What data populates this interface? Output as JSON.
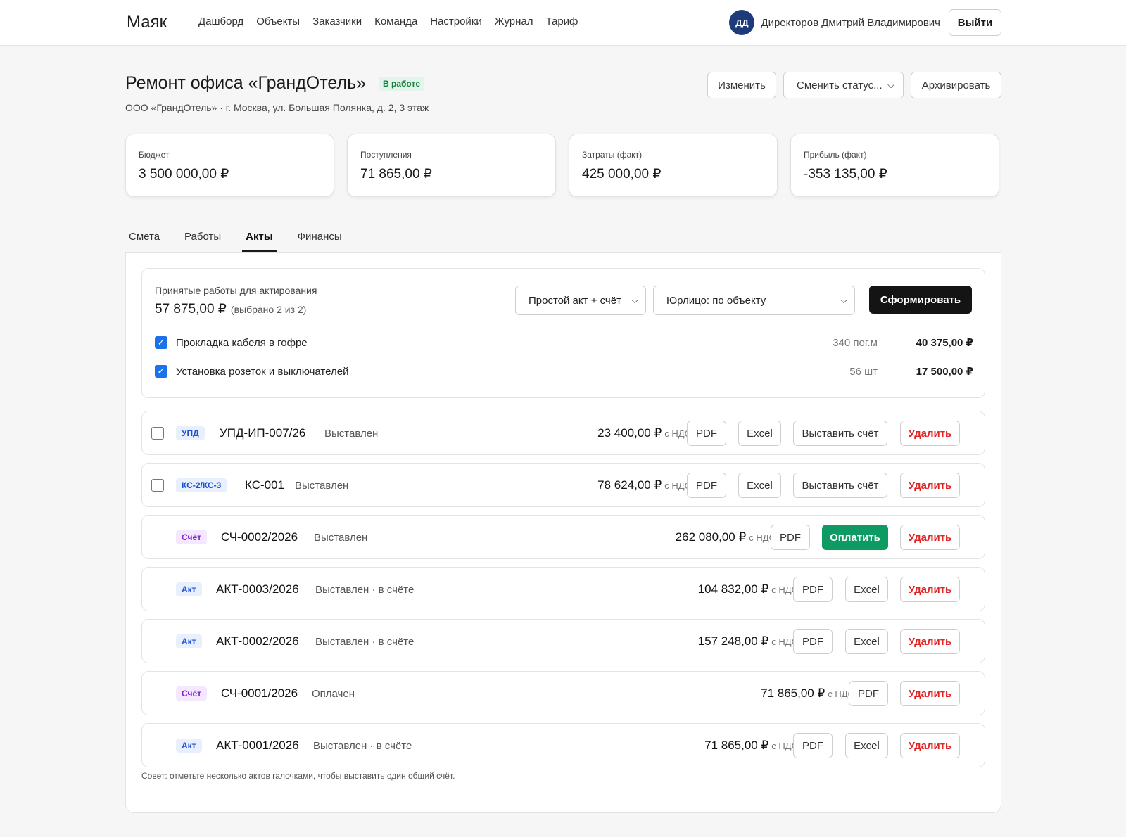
{
  "app": {
    "brand": "Маяк"
  },
  "nav": [
    "Дашборд",
    "Объекты",
    "Заказчики",
    "Команда",
    "Настройки",
    "Журнал",
    "Тариф"
  ],
  "user": {
    "initials": "ДД",
    "name": "Директоров Дмитрий Владимирович",
    "logout": "Выйти"
  },
  "project": {
    "title": "Ремонт офиса «ГрандОтель»",
    "status": "В работе",
    "subtitle": "ООО «ГрандОтель» · г. Москва, ул. Большая Полянка, д. 2, 3 этаж",
    "edit": "Изменить",
    "change_status": "Сменить статус...",
    "archive": "Архивировать"
  },
  "stats": [
    {
      "label": "Бюджет",
      "value": "3 500 000,00 ₽"
    },
    {
      "label": "Поступления",
      "value": "71 865,00 ₽"
    },
    {
      "label": "Затраты (факт)",
      "value": "425 000,00 ₽"
    },
    {
      "label": "Прибыль (факт)",
      "value": "-353 135,00 ₽"
    }
  ],
  "tabs": [
    "Смета",
    "Работы",
    "Акты",
    "Финансы"
  ],
  "active_tab": "Акты",
  "accept": {
    "label": "Принятые работы для актирования",
    "sum": "57 875,00 ₽",
    "selected": "(выбрано 2 из 2)",
    "doc_type": "Простой акт + счёт",
    "entity": "Юрлицо: по объекту",
    "submit": "Сформировать",
    "items": [
      {
        "name": "Прокладка кабеля в гофре",
        "qty": "340 пог.м",
        "amount": "40 375,00 ₽",
        "checked": true
      },
      {
        "name": "Установка розеток и выключателей",
        "qty": "56 шт",
        "amount": "17 500,00 ₽",
        "checked": true
      }
    ]
  },
  "vat_note": "с НДС",
  "buttons": {
    "pdf": "PDF",
    "excel": "Excel",
    "invoice": "Выставить счёт",
    "pay": "Оплатить",
    "delete": "Удалить"
  },
  "docs": [
    {
      "tag": "УПД",
      "number": "УПД-ИП-007/26",
      "status": "Выставлен",
      "amount": "23 400,00 ₽"
    },
    {
      "tag": "КС-2/КС-3",
      "number": "КС-001",
      "status": "Выставлен",
      "amount": "78 624,00 ₽"
    },
    {
      "tag": "Счёт",
      "number": "СЧ-0002/2026",
      "status": "Выставлен",
      "amount": "262 080,00 ₽"
    },
    {
      "tag": "Акт",
      "number": "АКТ-0003/2026",
      "status": "Выставлен · в счёте",
      "amount": "104 832,00 ₽"
    },
    {
      "tag": "Акт",
      "number": "АКТ-0002/2026",
      "status": "Выставлен · в счёте",
      "amount": "157 248,00 ₽"
    },
    {
      "tag": "Счёт",
      "number": "СЧ-0001/2026",
      "status": "Оплачен",
      "amount": "71 865,00 ₽"
    },
    {
      "tag": "Акт",
      "number": "АКТ-0001/2026",
      "status": "Выставлен · в счёте",
      "amount": "71 865,00 ₽"
    }
  ],
  "hint": "Совет: отметьте несколько актов галочками, чтобы выставить один общий счёт."
}
